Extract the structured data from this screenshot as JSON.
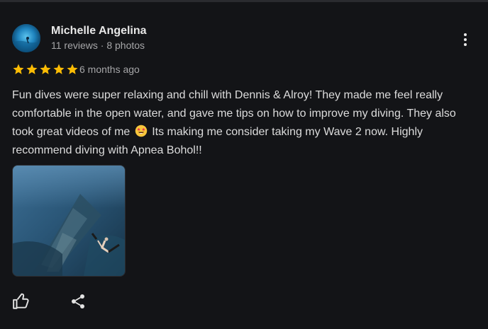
{
  "review": {
    "author": "Michelle Angelina",
    "author_meta": "11 reviews · 8 photos",
    "rating": 5,
    "rating_max": 5,
    "time": "6 months ago",
    "text_parts": [
      "Fun dives were super relaxing and chill with Dennis & Alroy! They made me feel really comfortable in the open water, and gave me tips on how to improve my diving. They also took great videos of me",
      "Its making me consider taking my Wave 2 now. Highly recommend diving with Apnea Bohol!!"
    ],
    "emoji": "star-struck-emoji"
  },
  "icons": {
    "more": "more-vert-icon",
    "like": "thumbs-up-icon",
    "share": "share-icon"
  },
  "colors": {
    "background": "#131417",
    "star": "#fbbc04",
    "text": "#dcdcdc",
    "secondary_text": "#a6a6a8"
  }
}
